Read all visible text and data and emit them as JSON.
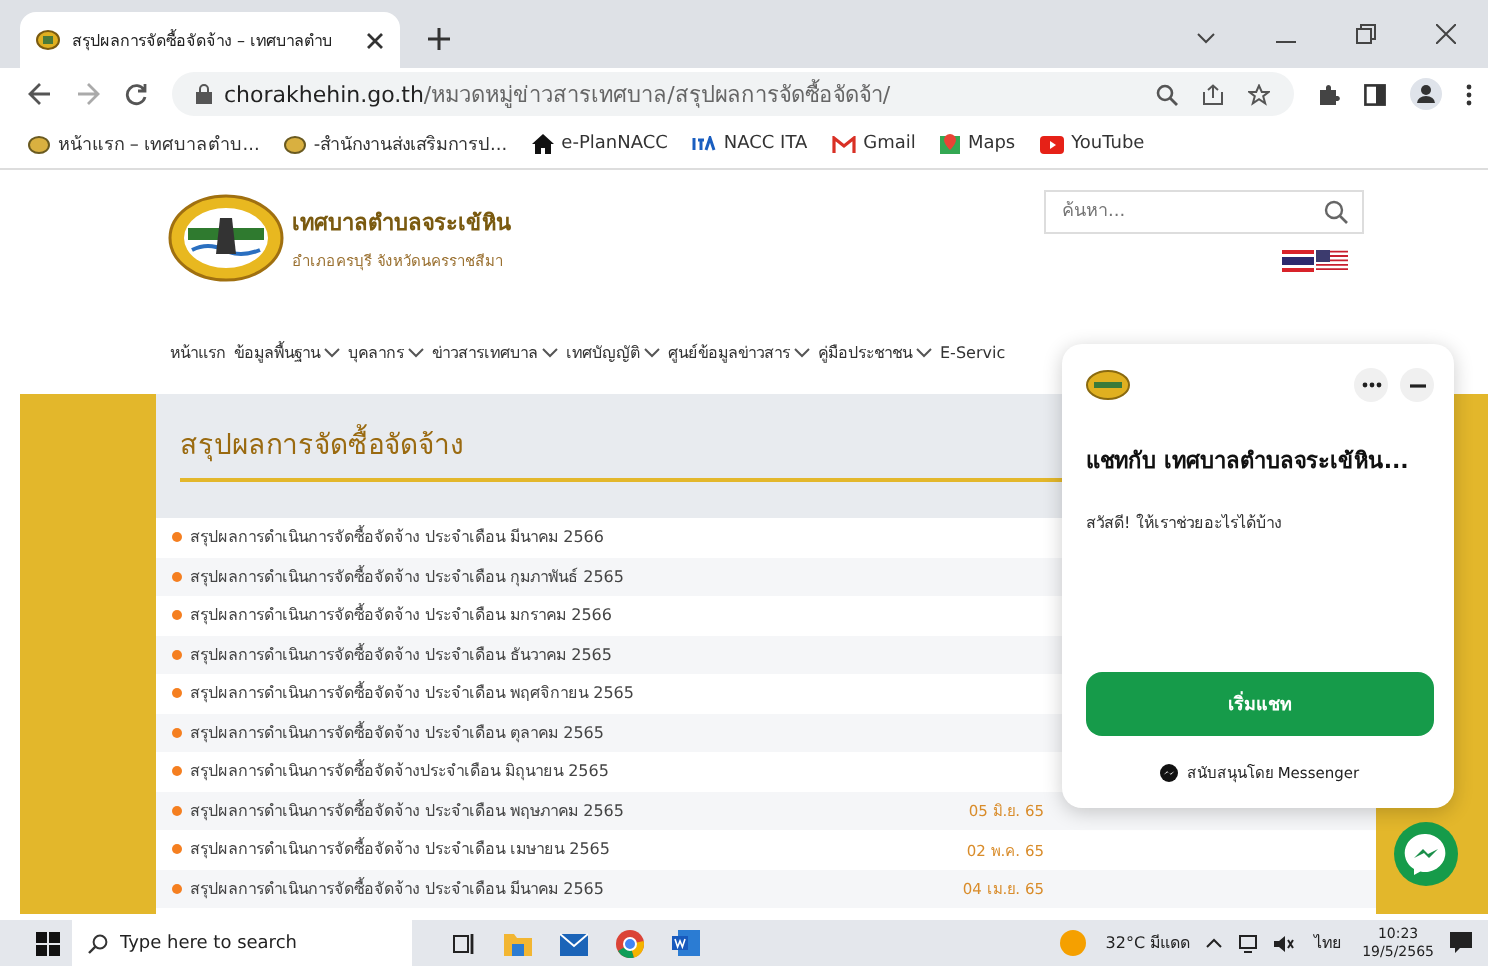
{
  "browser": {
    "tab_title": "สรุปผลการจัดซื้อจัดจ้าง – เทศบาลตำบ",
    "url_host": "chorakhehin.go.th",
    "url_path": "/หมวดหมู่ข่าวสารเทศบาล/สรุปผลการจัดซื้อจัดจ้า/",
    "bookmarks": [
      {
        "kind": "seal",
        "label": "หน้าแรก – เทศบาลตำบ..."
      },
      {
        "kind": "seal",
        "label": "-สำนักงานส่งเสริมการป..."
      },
      {
        "kind": "home",
        "label": "e-PlanNACC"
      },
      {
        "kind": "itа",
        "label": "NACC ITA"
      },
      {
        "kind": "mail",
        "label": "Gmail"
      },
      {
        "kind": "maps",
        "label": "Maps"
      },
      {
        "kind": "video",
        "label": "YouTube"
      }
    ]
  },
  "site": {
    "name": "เทศบาลตำบลจระเข้หิน",
    "subtitle": "อำเภอครบุรี  จังหวัดนครราชสีมา",
    "search": {
      "placeholder": "ค้นหา..."
    },
    "nav": [
      {
        "label": "หน้าแรก",
        "has_dropdown": false
      },
      {
        "label": "ข้อมูลพื้นฐาน",
        "has_dropdown": true
      },
      {
        "label": "บุคลากร",
        "has_dropdown": true
      },
      {
        "label": "ข่าวสารเทศบาล",
        "has_dropdown": true
      },
      {
        "label": "เทศบัญญัติ",
        "has_dropdown": true
      },
      {
        "label": "ศูนย์ข้อมูลข่าวสาร",
        "has_dropdown": true
      },
      {
        "label": "คู่มือประชาชน",
        "has_dropdown": true
      },
      {
        "label": "E-Servic",
        "has_dropdown": false
      }
    ]
  },
  "page": {
    "heading": "สรุปผลการจัดซื้อจัดจ้าง",
    "rows": [
      {
        "title": "สรุปผลการดำเนินการจัดซื้อจัดจ้าง ประจำเดือน มีนาคม 2566"
      },
      {
        "title": "สรุปผลการดำเนินการจัดซื้อจัดจ้าง ประจำเดือน กุมภาพันธ์ 2565"
      },
      {
        "title": "สรุปผลการดำเนินการจัดซื้อจัดจ้าง ประจำเดือน มกราคม 2566"
      },
      {
        "title": "สรุปผลการดำเนินการจัดซื้อจัดจ้าง ประจำเดือน ธันวาคม 2565"
      },
      {
        "title": "สรุปผลการดำเนินการจัดซื้อจัดจ้าง ประจำเดือน พฤศจิกายน 2565"
      },
      {
        "title": "สรุปผลการดำเนินการจัดซื้อจัดจ้าง ประจำเดือน ตุลาคม 2565"
      },
      {
        "title": "สรุปผลการดำเนินการจัดซื้อจัดจ้างประจำเดือน มิถุนายน 2565"
      },
      {
        "title": "สรุปผลการดำเนินการจัดซื้อจัดจ้าง ประจำเดือน พฤษภาคม 2565",
        "date": "05 มิ.ย. 65"
      },
      {
        "title": "สรุปผลการดำเนินการจัดซื้อจัดจ้าง ประจำเดือน เมษายน 2565",
        "date": "02 พ.ค. 65"
      },
      {
        "title": "สรุปผลการดำเนินการจัดซื้อจัดจ้าง ประจำเดือน มีนาคม 2565",
        "date": "04 เม.ย. 65"
      }
    ]
  },
  "chat": {
    "title": "แชทกับ เทศบาลตำบลจระเข้หิน...",
    "greeting": "สวัสดี! ให้เราช่วยอะไรได้บ้าง",
    "button": "เริ่มแชท",
    "footer": "สนับสนุนโดย Messenger"
  },
  "taskbar": {
    "search": {
      "placeholder": "Type here to search"
    },
    "weather": "32°C มีแดด",
    "language": "ไทย",
    "time": "10:23",
    "date": "19/5/2565"
  }
}
